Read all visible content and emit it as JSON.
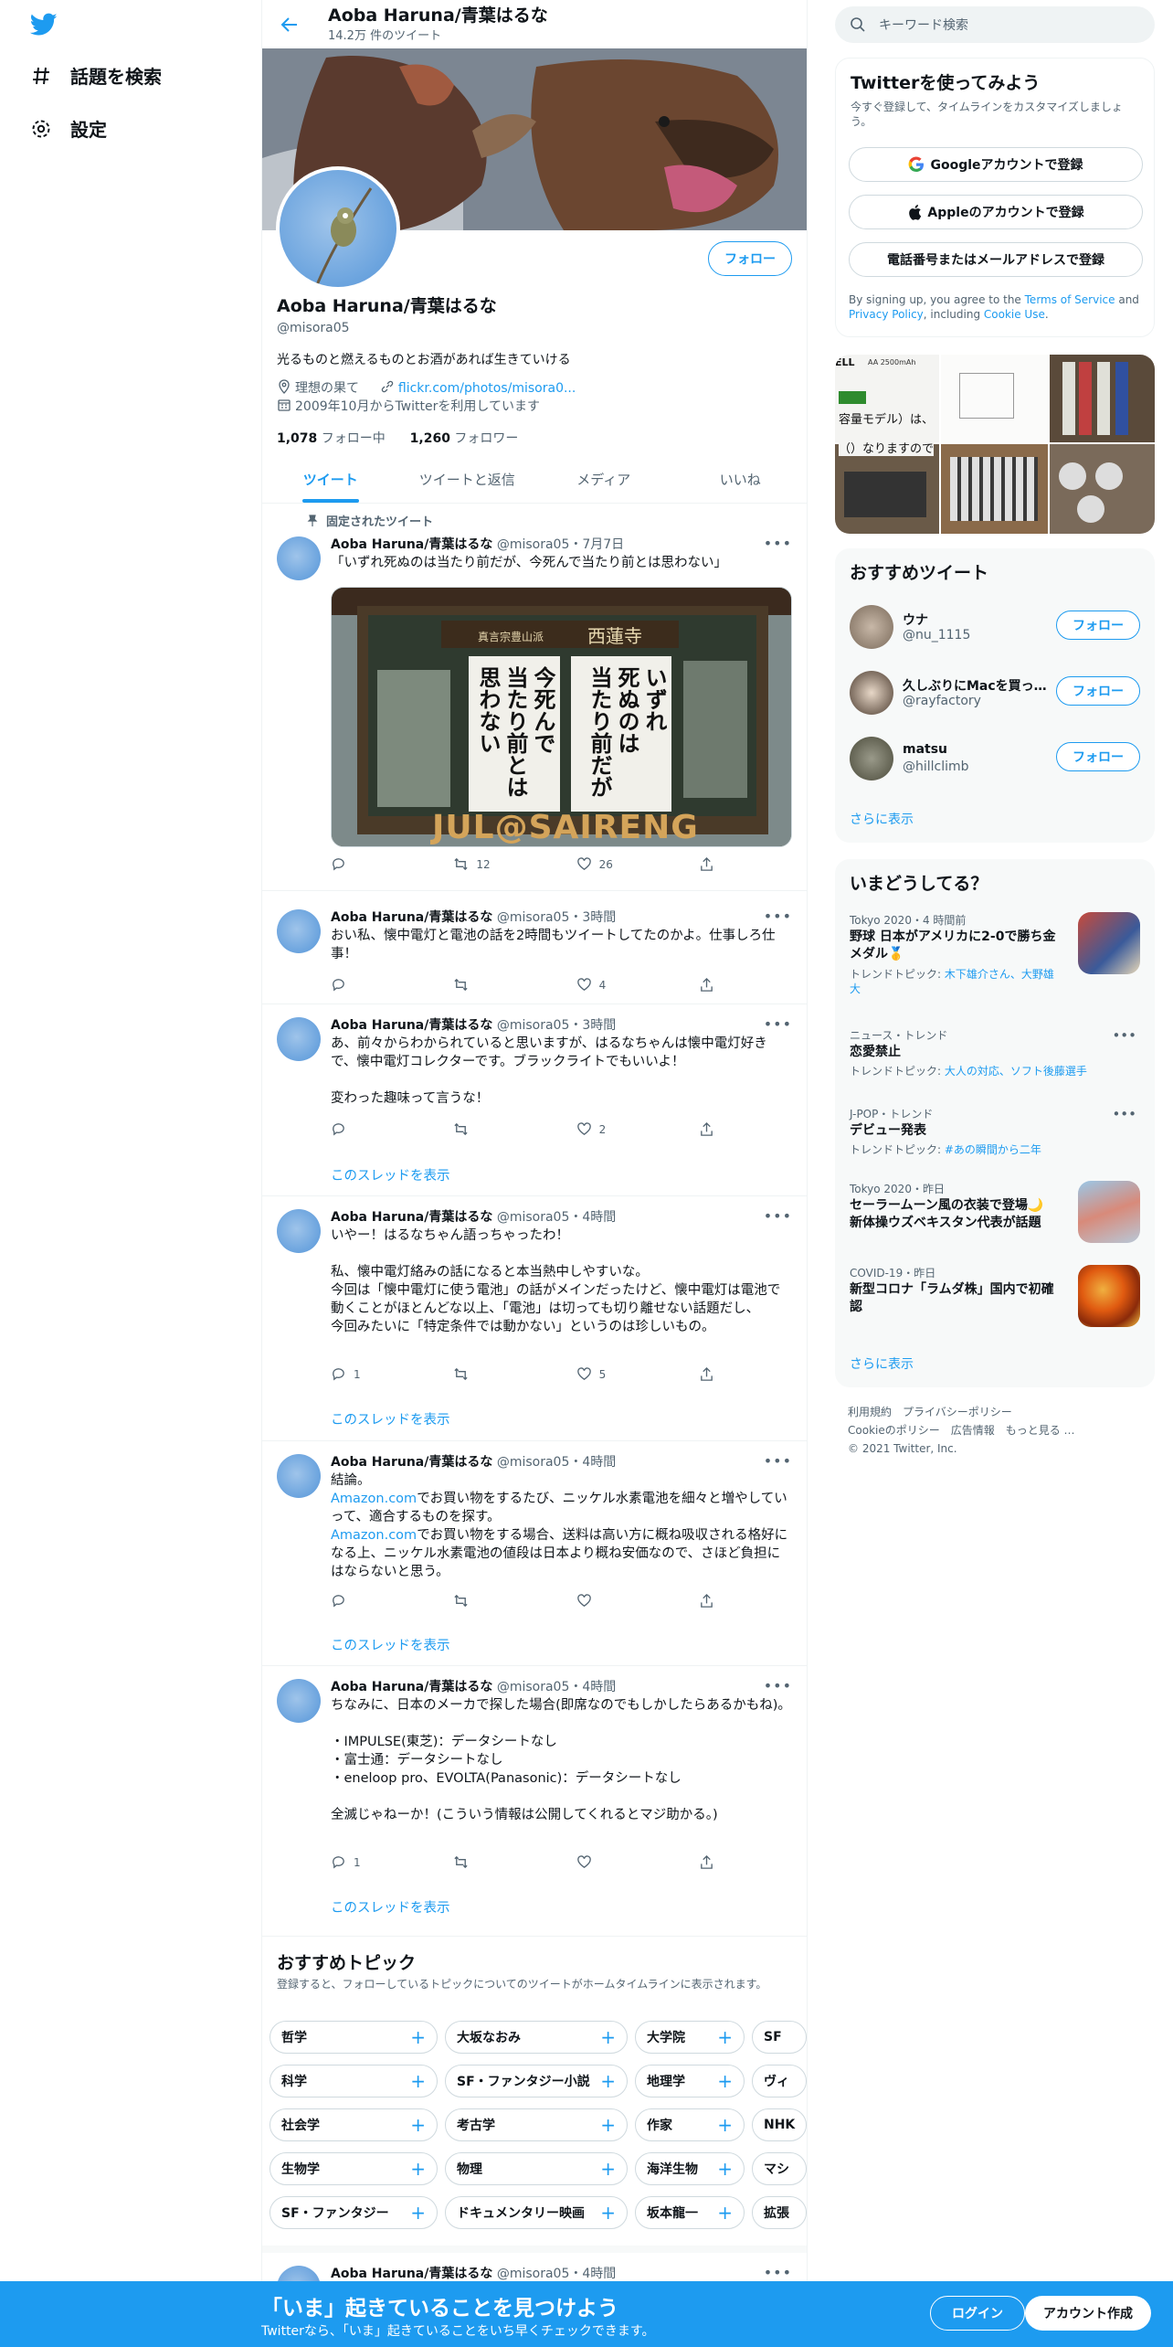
{
  "nav": {
    "explore": "話題を検索",
    "settings": "設定"
  },
  "header": {
    "name": "Aoba Haruna/青葉はるな",
    "tweet_count": "14.2万 件のツイート"
  },
  "profile": {
    "follow": "フォロー",
    "name": "Aoba Haruna/青葉はるな",
    "handle": "@misora05",
    "bio": "光るものと燃えるものとお酒があれば生きていける",
    "location": "理想の果て",
    "url": "flickr.com/photos/misora0...",
    "joined": "2009年10月からTwitterを利用しています",
    "following_count": "1,078",
    "following_label": "フォロー中",
    "followers_count": "1,260",
    "followers_label": "フォロワー"
  },
  "tabs": [
    "ツイート",
    "ツイートと返信",
    "メディア",
    "いいね"
  ],
  "pinned_label": "固定されたツイート",
  "tweets": [
    {
      "name": "Aoba Haruna/青葉はるな",
      "meta": "@misora05・7月7日",
      "text": "「いずれ死ぬのは当たり前だが、今死んで当たり前とは思わない」",
      "reply": "",
      "retweet": "12",
      "like": "26",
      "image": {
        "header_left": "真言宗豊山派",
        "header_right": "西蓮寺",
        "poster_left": "今死んで\n当たり前とは\n思わない",
        "poster_right": "いずれ\n死ぬのは\n当たり前だが",
        "bottom": "JUL@SAIRENG"
      }
    },
    {
      "name": "Aoba Haruna/青葉はるな",
      "meta": "@misora05・3時間",
      "text": "おい私、懐中電灯と電池の話を2時間もツイートしてたのかよ。仕事しろ仕\n事！",
      "reply": "",
      "retweet": "",
      "like": "4"
    },
    {
      "name": "Aoba Haruna/青葉はるな",
      "meta": "@misora05・3時間",
      "text": "あ、前々からわかられていると思いますが、はるなちゃんは懐中電灯好きで、懐中電灯コレクターです。ブラックライトでもいいよ！\n\n変わった趣味って言うな！",
      "reply": "",
      "retweet": "",
      "like": "2",
      "thread": "このスレッドを表示"
    },
    {
      "name": "Aoba Haruna/青葉はるな",
      "meta": "@misora05・4時間",
      "text": "いやー！はるなちゃん語っちゃったわ！\n\n私、懐中電灯絡みの話になると本当熱中しやすいな。\n今回は「懐中電灯に使う電池」の話がメインだったけど、懐中電灯は電池で動くことがほとんどな以上、「電池」は切っても切り離せない話題だし、\n今回みたいに「特定条件では動かない」というのは珍しいもの。",
      "reply": "1",
      "retweet": "",
      "like": "5",
      "thread": "このスレッドを表示"
    },
    {
      "name": "Aoba Haruna/青葉はるな",
      "meta": "@misora05・4時間",
      "text_parts": [
        {
          "t": "結論。\n",
          "link": false
        },
        {
          "t": "Amazon.com",
          "link": true
        },
        {
          "t": "でお買い物をするたび、ニッケル水素電池を細々と増やしていって、適合するものを探す。\n",
          "link": false
        },
        {
          "t": "Amazon.com",
          "link": true
        },
        {
          "t": "でお買い物をする場合、送料は高い方に概ね吸収される格好になる上、ニッケル水素電池の値段は日本より概ね安価なので、さほど負担にはならないと思う。",
          "link": false
        }
      ],
      "reply": "",
      "retweet": "",
      "like": "",
      "thread": "このスレッドを表示"
    },
    {
      "name": "Aoba Haruna/青葉はるな",
      "meta": "@misora05・4時間",
      "text": "ちなみに、日本のメーカで探した場合(即席なのでもしかしたらあるかもね)。\n\n・IMPULSE(東芝)：データシートなし\n・富士通：データシートなし\n・eneloop pro、EVOLTA(Panasonic)：データシートなし\n\n全滅じゃねーか！(こういう情報は公開してくれるとマジ助かる。)",
      "reply": "1",
      "retweet": "",
      "like": "",
      "thread": "このスレッドを表示"
    }
  ],
  "topics": {
    "title": "おすすめトピック",
    "subtitle": "登録すると、フォローしているトピックについてのツイートがホームタイムラインに表示されます。",
    "rows": [
      [
        "哲学",
        "大坂なおみ",
        "大学院",
        "SF"
      ],
      [
        "科学",
        "SF・ファンタジー小説",
        "地理学",
        "ヴィ"
      ],
      [
        "社会学",
        "考古学",
        "作家",
        "NHK"
      ],
      [
        "生物学",
        "物理",
        "海洋生物",
        "マシ"
      ],
      [
        "SF・ファンタジー",
        "ドキュメンタリー映画",
        "坂本龍一",
        "拡張"
      ]
    ]
  },
  "last_tweet": {
    "name": "Aoba Haruna/青葉はるな",
    "meta": "@misora05・4時間"
  },
  "right": {
    "search_placeholder": "キーワード検索",
    "signup": {
      "title": "Twitterを使ってみよう",
      "desc": "今すぐ登録して、タイムラインをカスタマイズしましょう。",
      "google": "Googleアカウントで登録",
      "apple": "Appleのアカウントで登録",
      "phone": "電話番号またはメールアドレスで登録",
      "terms_1": "By signing up, you agree to the ",
      "terms_link1": "Terms of Service",
      "terms_2": " and ",
      "terms_link2": "Privacy Policy",
      "terms_3": ", including ",
      "terms_link3": "Cookie Use",
      "terms_4": "."
    },
    "media_text": {
      "brand": "ELL",
      "spec": "AA 2500mAh",
      "line1": "容量モデル）は、",
      "line2": "（）なりますので"
    },
    "recommend": {
      "title": "おすすめツイート",
      "users": [
        {
          "name": "ウナ",
          "handle": "@nu_1115",
          "follow": "フォロー"
        },
        {
          "name": "久しぶりにMacを買っ…",
          "handle": "@rayfactory",
          "follow": "フォロー"
        },
        {
          "name": "matsu",
          "handle": "@hillclimb",
          "follow": "フォロー"
        }
      ],
      "more": "さらに表示"
    },
    "trends": {
      "title": "いまどうしてる？",
      "items": [
        {
          "cat": "Tokyo 2020・4 時間前",
          "name": "野球 日本がアメリカに2-0で勝ち金メダル🥇",
          "meta_label": "トレンドトピック: ",
          "meta_link": "木下雄介さん、大野雄大"
        },
        {
          "cat": "ニュース・トレンド",
          "name": "恋愛禁止",
          "meta_label": "トレンドトピック: ",
          "meta_link": "大人の対応、ソフト後藤選手"
        },
        {
          "cat": "J-POP・トレンド",
          "name": "デビュー発表",
          "meta_label": "トレンドトピック: ",
          "meta_link": "#あの瞬間から二年"
        },
        {
          "cat": "Tokyo 2020・昨日",
          "name": "セーラームーン風の衣装で登場🌙 新体操ウズベキスタン代表が話題",
          "meta_label": "",
          "meta_link": ""
        },
        {
          "cat": "COVID-19・昨日",
          "name": "新型コロナ「ラムダ株」国内で初確認",
          "meta_label": "",
          "meta_link": ""
        }
      ],
      "more": "さらに表示"
    },
    "footer": {
      "line1": "利用規約　プライバシーポリシー",
      "line2": "Cookieのポリシー　広告情報　もっと見る …",
      "line3": "© 2021 Twitter, Inc."
    }
  },
  "bottombar": {
    "title": "「いま」起きていることを見つけよう",
    "subtitle": "Twitterなら、「いま」起きていることをいち早くチェックできます。",
    "login": "ログイン",
    "signup": "アカウント作成"
  },
  "colors": {
    "accent": "#1d9bf0",
    "bottombar": "#1d9bf0"
  }
}
